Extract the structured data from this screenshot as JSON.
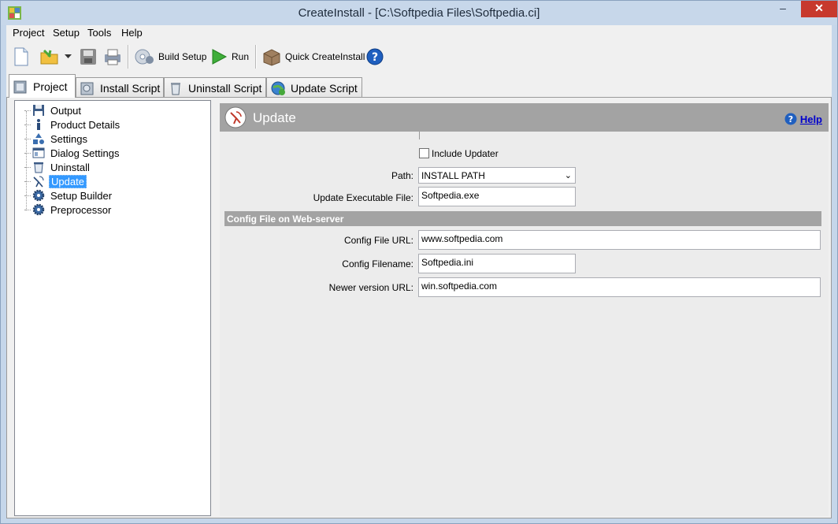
{
  "window": {
    "title": "CreateInstall - [C:\\Softpedia Files\\Softpedia.ci]",
    "min_glyph": "–",
    "max_glyph": "□",
    "close_glyph": "✕"
  },
  "menu": [
    "Project",
    "Setup",
    "Tools",
    "Help"
  ],
  "toolbar": {
    "build_setup_label": "Build Setup",
    "run_label": "Run",
    "quick_label": "Quick CreateInstall"
  },
  "tabs": [
    "Project",
    "Install Script",
    "Uninstall Script",
    "Update Script"
  ],
  "tree": [
    "Output",
    "Product Details",
    "Settings",
    "Dialog Settings",
    "Uninstall",
    "Update",
    "Setup Builder",
    "Preprocessor"
  ],
  "panel": {
    "title": "Update",
    "help": "Help",
    "include_updater_label": "Include Updater",
    "include_updater_checked": false,
    "path_label": "Path:",
    "path_value": "INSTALL PATH",
    "exe_label": "Update Executable File:",
    "exe_value": "Softpedia.exe",
    "section_title": "Config File on Web-server",
    "config_url_label": "Config File URL:",
    "config_url_value": "www.softpedia.com",
    "config_filename_label": "Config Filename:",
    "config_filename_value": "Softpedia.ini",
    "newer_url_label": "Newer version URL:",
    "newer_url_value": "win.softpedia.com"
  },
  "colors": {
    "panel_header": "#a3a3a3",
    "selection": "#3399ff",
    "link": "#0000cc"
  }
}
